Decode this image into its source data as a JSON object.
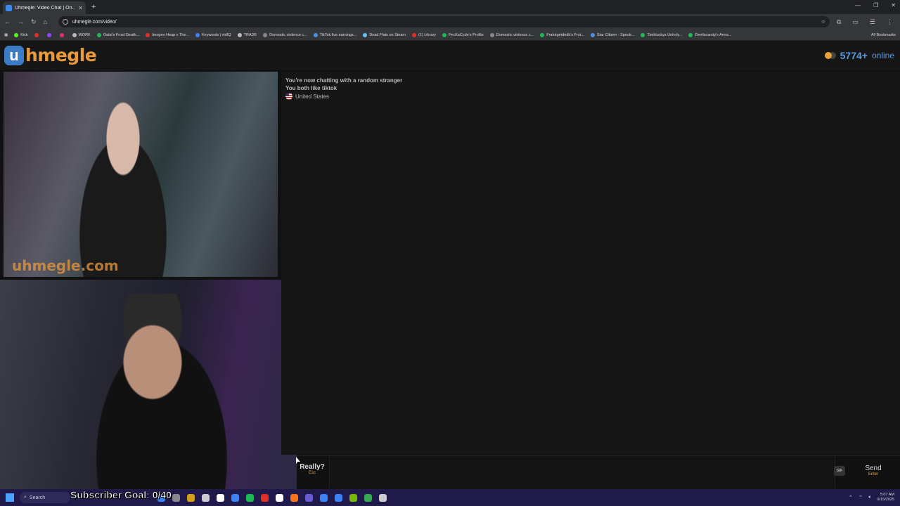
{
  "browser": {
    "tab_title": "Uhmegle: Video Chat | On...",
    "url": "uhmegle.com/video/",
    "bookmarks": [
      {
        "label": "Kick",
        "color": "#53fc18"
      },
      {
        "label": "",
        "color": "#e52d27"
      },
      {
        "label": "",
        "color": "#9146ff"
      },
      {
        "label": "",
        "color": "#e1306c"
      },
      {
        "label": "WORK",
        "color": "#bbbbbb"
      },
      {
        "label": "Galai's Frost Death...",
        "color": "#1db954"
      },
      {
        "label": "Imogen Heap x The...",
        "color": "#e52d27"
      },
      {
        "label": "Keywords | vidIQ",
        "color": "#3b82f6"
      },
      {
        "label": "TRADE",
        "color": "#bbbbbb"
      },
      {
        "label": "Domestic violence c...",
        "color": "#888888"
      },
      {
        "label": "TikTok live earnings...",
        "color": "#4a90e2"
      },
      {
        "label": "Dead Flats on Steam",
        "color": "#66c0f4"
      },
      {
        "label": "(1) Library",
        "color": "#e52d27"
      },
      {
        "label": "FecKaCyde's Profile",
        "color": "#1db954"
      },
      {
        "label": "Domestic violence c...",
        "color": "#888888"
      },
      {
        "label": "Fratotgetdedk's Frot...",
        "color": "#1db954"
      },
      {
        "label": "Star Citizen - Spectr...",
        "color": "#4a90e2"
      },
      {
        "label": "Timbluckys Unholy...",
        "color": "#1db954"
      },
      {
        "label": "Devilscandy's Arms...",
        "color": "#1db954"
      }
    ],
    "all_bookmarks": "All Bookmarks"
  },
  "site": {
    "logo_mark": "u",
    "logo_text": "hmegle",
    "online_count": "5774+",
    "online_label": "online",
    "watermark": "uhmegle.com"
  },
  "chat": {
    "line1": "You're now chatting with a random stranger",
    "line2": "You both like tiktok",
    "country": "United States"
  },
  "controls": {
    "stop_label": "Really?",
    "stop_key": "Esc",
    "input_placeholder": "",
    "gif_label": "GIF",
    "send_label": "Send",
    "send_key": "Enter"
  },
  "overlay": {
    "subscriber_goal": "Subscriber Goal: 0/40"
  },
  "taskbar": {
    "search_label": "Search",
    "time": "5:07 AM",
    "date": "9/15/2025",
    "apps": [
      "#3b82f6",
      "#888888",
      "#d4a017",
      "#cccccc",
      "#ffffff",
      "#3b82f6",
      "#1db954",
      "#e52d27",
      "#ffffff",
      "#f97316",
      "#6b5bd2",
      "#3b82f6",
      "#3b82f6",
      "#76b900",
      "#34a853",
      "#cccccc"
    ]
  }
}
